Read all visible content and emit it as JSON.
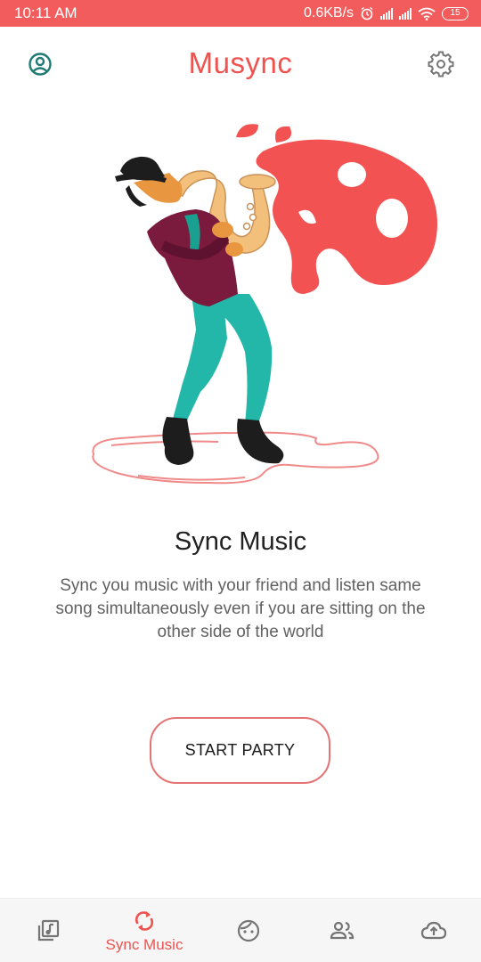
{
  "status_bar": {
    "time": "10:11 AM",
    "network_speed": "0.6KB/s",
    "battery_level": "15",
    "icons": [
      "alarm-icon",
      "signal-icon",
      "signal-icon",
      "wifi-icon",
      "battery-icon"
    ]
  },
  "app_bar": {
    "title": "Musync",
    "left_icon": "profile-icon",
    "right_icon": "gear-icon"
  },
  "hero": {
    "illustration": "saxophone-player-illustration"
  },
  "main": {
    "headline": "Sync Music",
    "description": "Sync you music with your friend and listen same song simultaneously even if you are sitting on the other side of the world",
    "start_button": "START PARTY"
  },
  "bottom_nav": {
    "active_index": 1,
    "items": [
      {
        "icon": "music-library-icon",
        "label": ""
      },
      {
        "icon": "sync-icon",
        "label": "Sync Music"
      },
      {
        "icon": "face-icon",
        "label": ""
      },
      {
        "icon": "people-icon",
        "label": ""
      },
      {
        "icon": "cloud-upload-icon",
        "label": ""
      }
    ]
  },
  "colors": {
    "accent": "#ef5350",
    "status_bar": "#f25c5c",
    "inactive_icon": "#757575",
    "button_border": "#e57373"
  }
}
